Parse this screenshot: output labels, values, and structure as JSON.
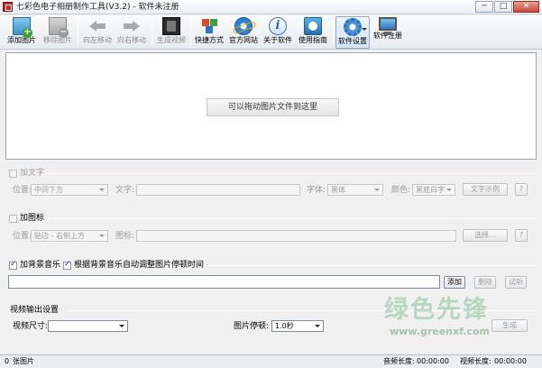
{
  "window": {
    "title": "七彩色电子相册制作工具(V3.2) - 软件未注册",
    "minimize": "─",
    "maximize": "□",
    "close": "✕"
  },
  "toolbar": {
    "add_image": "添加图片",
    "remove_image": "移除图片",
    "move_left": "向左移动",
    "move_right": "向右移动",
    "generate_video": "生成视频",
    "shortcut": "快捷方式",
    "website": "官方网站",
    "about": "关于软件",
    "guide": "使用指南",
    "settings": "软件设置",
    "register": "软件注册"
  },
  "dropzone": {
    "hint": "可以拖动图片文件到这里"
  },
  "text_section": {
    "checkbox_label": "加文字",
    "position_label": "位置:",
    "position_value": "中间下方",
    "text_label": "文字:",
    "text_value": "",
    "font_label": "字体:",
    "font_value": "黑体",
    "color_label": "颜色:",
    "color_value": "黑底白字",
    "sample_button": "文字示例",
    "help_button": "?"
  },
  "logo_section": {
    "checkbox_label": "加图标",
    "position_label": "位置:",
    "position_value": "贴边 - 右侧上方",
    "icon_label": "图标:",
    "icon_value": "",
    "choose_button": "选择...",
    "help_button": "?"
  },
  "music_section": {
    "music_label": "加背景音乐",
    "auto_adjust_label": "根据背景音乐自动调整图片停顿时间",
    "music_path": "",
    "add_button": "添加",
    "delete_button": "删除",
    "listen_button": "试听"
  },
  "video_section": {
    "heading": "视频输出设置",
    "size_label": "视频尺寸:",
    "size_value": "",
    "pause_label": "图片停顿:",
    "pause_value": "1.0秒",
    "generate_button": "生成"
  },
  "statusbar": {
    "count": "0",
    "count_unit": "张图片",
    "audio_label": "音频长度:",
    "audio_value": "00:00:00",
    "video_label": "视频长度:",
    "video_value": "00:00:00"
  },
  "watermark": {
    "brand": "绿色先锋",
    "url": "www.greenxf.com"
  }
}
